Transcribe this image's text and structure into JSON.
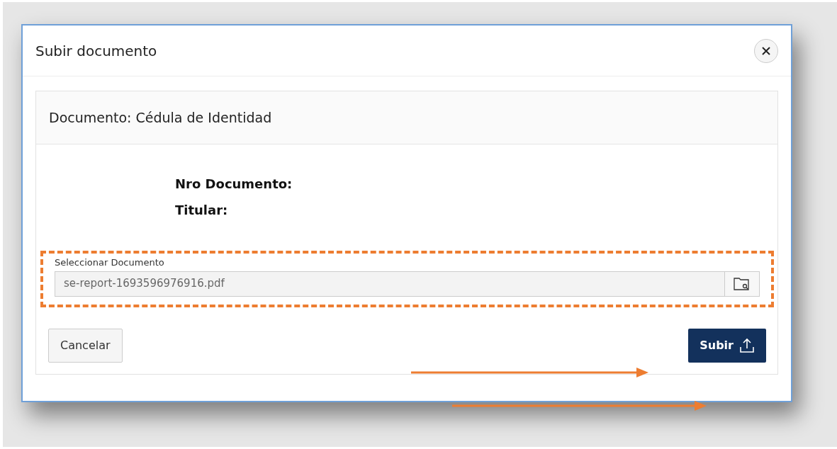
{
  "modal": {
    "title": "Subir documento"
  },
  "card": {
    "title": "Documento: Cédula de Identidad",
    "fields": [
      {
        "label": "Nro Documento:"
      },
      {
        "label": "Titular:"
      }
    ],
    "file_field": {
      "label": "Seleccionar Documento",
      "value": "se-report-1693596976916.pdf"
    }
  },
  "buttons": [
    {
      "label": "Cancelar",
      "kind": "secondary"
    },
    {
      "label": "Subir",
      "kind": "primary"
    }
  ]
}
